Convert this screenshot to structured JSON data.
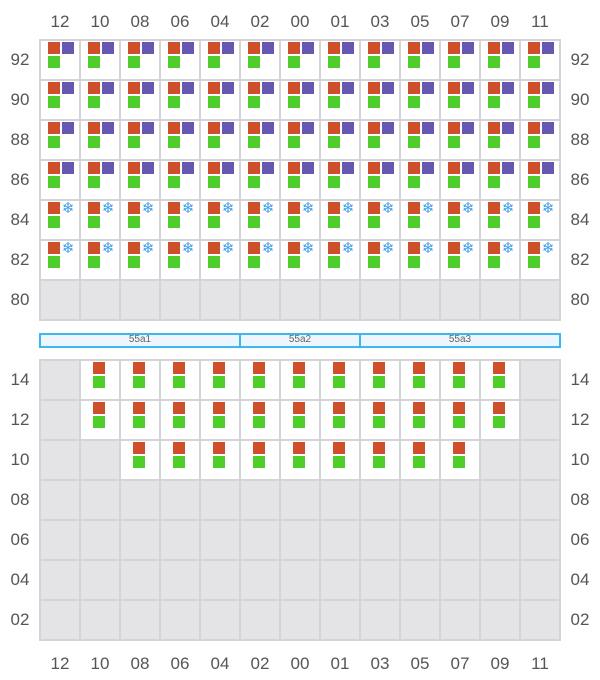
{
  "columns": [
    "12",
    "10",
    "08",
    "06",
    "04",
    "02",
    "00",
    "01",
    "03",
    "05",
    "07",
    "09",
    "11"
  ],
  "top_rows": [
    {
      "label": "92",
      "content": "full"
    },
    {
      "label": "90",
      "content": "full"
    },
    {
      "label": "88",
      "content": "full"
    },
    {
      "label": "86",
      "content": "full"
    },
    {
      "label": "84",
      "content": "snow"
    },
    {
      "label": "82",
      "content": "snow"
    },
    {
      "label": "80",
      "content": "empty"
    }
  ],
  "bands": [
    {
      "label": "55a1",
      "span": 5
    },
    {
      "label": "55a2",
      "span": 3
    },
    {
      "label": "55a3",
      "span": 5
    }
  ],
  "bottom_rows": [
    {
      "label": "14",
      "occupied": [
        "10",
        "08",
        "06",
        "04",
        "02",
        "00",
        "01",
        "03",
        "05",
        "07",
        "09"
      ]
    },
    {
      "label": "12",
      "occupied": [
        "10",
        "08",
        "06",
        "04",
        "02",
        "00",
        "01",
        "03",
        "05",
        "07",
        "09"
      ]
    },
    {
      "label": "10",
      "occupied": [
        "08",
        "06",
        "04",
        "02",
        "00",
        "01",
        "03",
        "05",
        "07"
      ]
    },
    {
      "label": "08",
      "occupied": []
    },
    {
      "label": "06",
      "occupied": []
    },
    {
      "label": "04",
      "occupied": []
    },
    {
      "label": "02",
      "occupied": []
    }
  ],
  "snow_glyph": "❄",
  "colors": {
    "orange": "#cd502b",
    "purple": "#6658b0",
    "green": "#4fcd2b",
    "snow": "#3d9be8",
    "band": "#3bb8f0"
  }
}
